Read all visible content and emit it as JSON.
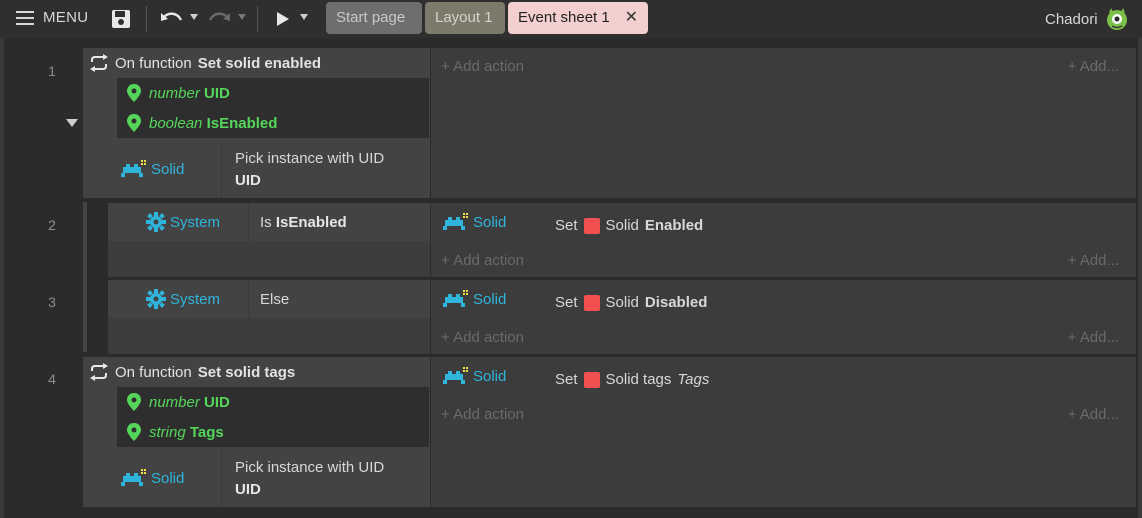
{
  "toolbar": {
    "menu_label": "MENU",
    "icons": [
      "hamburger-icon",
      "save-icon",
      "undo-icon",
      "redo-icon",
      "play-icon"
    ]
  },
  "tabs": [
    {
      "label": "Start page"
    },
    {
      "label": "Layout 1"
    },
    {
      "label": "Event sheet 1",
      "close": "✕"
    }
  ],
  "user": {
    "name": "Chadori"
  },
  "events": [
    {
      "number": "1",
      "func_prefix": "On function",
      "func_name": "Set solid enabled",
      "params": [
        {
          "type": "number",
          "name": "UID"
        },
        {
          "type": "boolean",
          "name": "IsEnabled"
        }
      ],
      "cond_object": "Solid",
      "cond_line1": "Pick instance with UID",
      "cond_line2": "UID",
      "add_action": "Add action",
      "add_right": "Add..."
    },
    {
      "number": "2",
      "cond_object": "System",
      "cond_prefix": "Is",
      "cond_bold": "IsEnabled",
      "act_object": "Solid",
      "act_prefix": "Set",
      "act_text": "Solid",
      "act_bold": "Enabled",
      "add_action": "Add action",
      "add_right": "Add..."
    },
    {
      "number": "3",
      "cond_object": "System",
      "cond_text": "Else",
      "act_object": "Solid",
      "act_prefix": "Set",
      "act_text": "Solid",
      "act_bold": "Disabled",
      "add_action": "Add action",
      "add_right": "Add..."
    },
    {
      "number": "4",
      "func_prefix": "On function",
      "func_name": "Set solid tags",
      "params": [
        {
          "type": "number",
          "name": "UID"
        },
        {
          "type": "string",
          "name": "Tags"
        }
      ],
      "cond_object": "Solid",
      "cond_line1": "Pick instance with UID",
      "cond_line2": "UID",
      "act_object": "Solid",
      "act_prefix": "Set",
      "act_text": "Solid tags",
      "act_italic": "Tags",
      "add_action": "Add action",
      "add_right": "Add..."
    }
  ],
  "colors": {
    "accent_object": "#2fb4dc",
    "param_green": "#55d65a",
    "active_tab": "#f4cfcf",
    "instance_var": "#f05050"
  }
}
